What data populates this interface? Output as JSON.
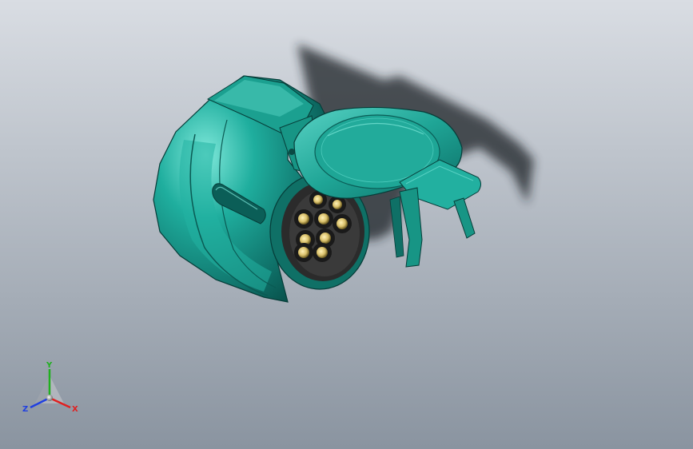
{
  "viewport": {
    "background_top": "#d9dde3",
    "background_bottom": "#8a94a0"
  },
  "model": {
    "body_color": "#1a9a8c",
    "body_dark": "#0c5f58",
    "body_light": "#6fe0d2",
    "pin_color": "#e8d58a",
    "pin_socket": "#2a2a2a"
  },
  "triad": {
    "x_label": "X",
    "y_label": "Y",
    "z_label": "Z",
    "x_color": "#e02020",
    "y_color": "#20b020",
    "z_color": "#2040e0"
  }
}
